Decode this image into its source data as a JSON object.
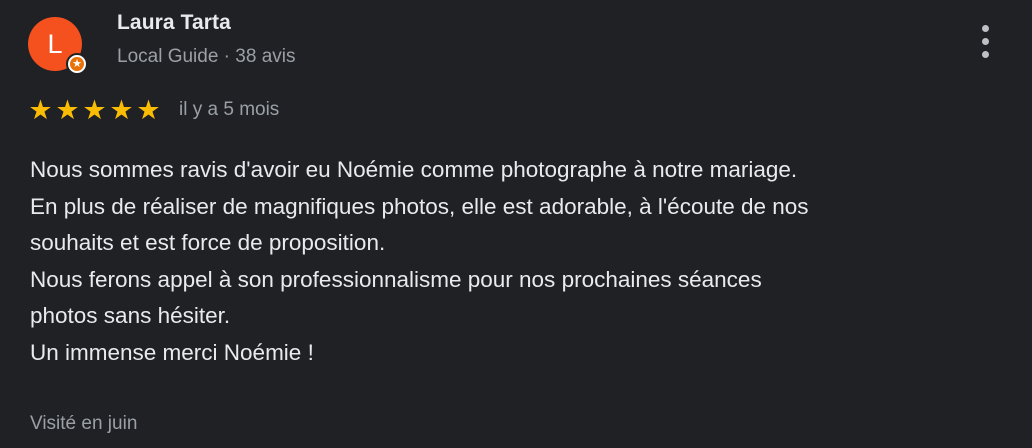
{
  "author": {
    "initial": "L",
    "name": "Laura Tarta",
    "meta": "Local Guide · 38 avis",
    "avatar_color": "#f4511e",
    "badge_icon": "local-guide-star-icon"
  },
  "review": {
    "rating": 5,
    "rating_max": 5,
    "star_glyph": "★",
    "star_color": "#fbbc04",
    "relative_date": "il y a 5 mois",
    "text_lines": [
      "Nous sommes ravis d'avoir eu Noémie comme photographe à notre mariage.",
      "En plus de réaliser de magnifiques photos, elle est adorable, à l'écoute de nos",
      "souhaits et est force de proposition.",
      "Nous ferons appel à son professionnalisme pour nos prochaines séances",
      "photos sans hésiter.",
      "Un immense merci Noémie !"
    ],
    "visited": "Visité en juin"
  },
  "actions": {
    "more_icon": "more-vertical-icon"
  }
}
